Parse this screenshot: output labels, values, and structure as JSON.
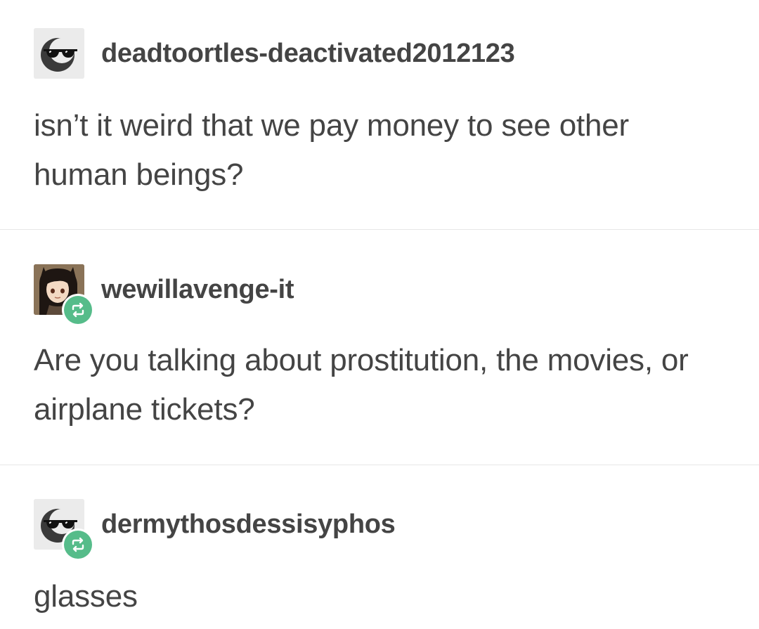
{
  "posts": [
    {
      "username": "deadtoortles-deactivated2012123",
      "avatar_icon": "sunglasses-moon-avatar",
      "reblog": false,
      "text": "isn’t it weird that we pay money to see other human beings?"
    },
    {
      "username": "wewillavenge-it",
      "avatar_icon": "anime-girl-avatar",
      "reblog": true,
      "text": "Are you talking about prostitution, the movies, or airplane tickets?"
    },
    {
      "username": "dermythosdessisyphos",
      "avatar_icon": "sunglasses-moon-avatar",
      "reblog": true,
      "text": "glasses"
    }
  ],
  "colors": {
    "text": "#444444",
    "reblog_badge": "#56bc8a",
    "divider": "#e6e6e6",
    "avatar_bg": "#ebebeb"
  }
}
